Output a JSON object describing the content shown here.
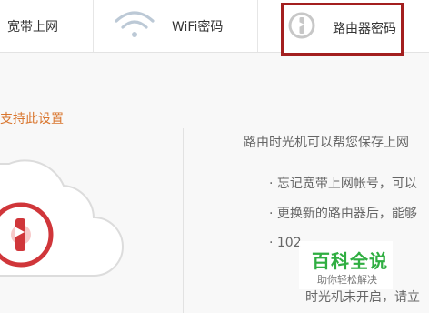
{
  "tabs": [
    {
      "label": "宽带上网",
      "icon": null
    },
    {
      "label": "WiFi密码",
      "icon": "wifi-icon"
    },
    {
      "label": "路由器密码",
      "icon": "lock-icon",
      "highlighted": true
    }
  ],
  "left": {
    "support_link": "支持此设置",
    "illustration": "cloud-lock-icon"
  },
  "right": {
    "intro": "路由时光机可以帮您保存上网",
    "bullets": [
      "· 忘记宽带上网帐号，可以",
      "· 更换新的路由器后，能够",
      "· 102"
    ],
    "footer": "时光机未开启，请立"
  },
  "watermark": {
    "title": "百科全说",
    "subtitle": "助你轻松解决"
  },
  "colors": {
    "highlight_border": "#a31f1f",
    "link": "#d9752d",
    "icon_red": "#d0363a",
    "watermark_green": "#2fae41"
  }
}
